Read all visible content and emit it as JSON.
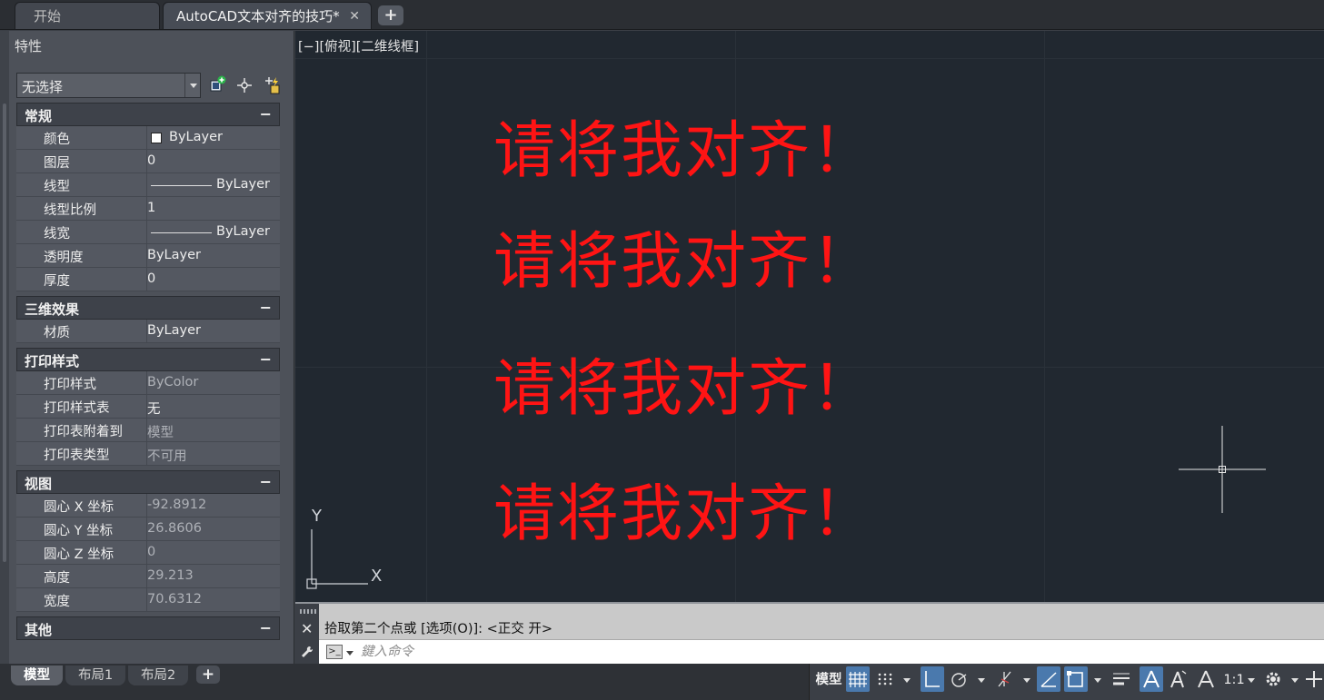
{
  "tabs": {
    "start": "开始",
    "active": "AutoCAD文本对齐的技巧*",
    "close_glyph": "✕",
    "add_glyph": "+"
  },
  "properties": {
    "title": "特性",
    "selection": "无选择",
    "sections": {
      "general": "常规",
      "three_d": "三维效果",
      "plot_style": "打印样式",
      "view": "视图",
      "misc": "其他"
    },
    "collapse_glyph": "−",
    "general": {
      "color": {
        "name": "颜色",
        "value": "ByLayer"
      },
      "layer": {
        "name": "图层",
        "value": "0"
      },
      "linetype": {
        "name": "线型",
        "value": "ByLayer"
      },
      "linetype_scale": {
        "name": "线型比例",
        "value": "1"
      },
      "lineweight": {
        "name": "线宽",
        "value": "ByLayer"
      },
      "transparency": {
        "name": "透明度",
        "value": "ByLayer"
      },
      "thickness": {
        "name": "厚度",
        "value": "0"
      }
    },
    "three_d": {
      "material": {
        "name": "材质",
        "value": "ByLayer"
      }
    },
    "plot_style": {
      "style": {
        "name": "打印样式",
        "value": "ByColor"
      },
      "table": {
        "name": "打印样式表",
        "value": "无"
      },
      "attached_to": {
        "name": "打印表附着到",
        "value": "模型"
      },
      "table_type": {
        "name": "打印表类型",
        "value": "不可用"
      }
    },
    "view": {
      "center_x": {
        "name": "圆心 X 坐标",
        "value": "-92.8912"
      },
      "center_y": {
        "name": "圆心 Y 坐标",
        "value": "26.8606"
      },
      "center_z": {
        "name": "圆心 Z 坐标",
        "value": "0"
      },
      "height": {
        "name": "高度",
        "value": "29.213"
      },
      "width": {
        "name": "宽度",
        "value": "70.6312"
      }
    }
  },
  "canvas": {
    "view_label": "[−][俯视][二维线框]",
    "text_lines": [
      "请将我对齐！",
      "请将我对齐！",
      "请将我对齐！",
      "请将我对齐！"
    ],
    "text_color": "#ff1414",
    "ucs_x": "X",
    "ucs_y": "Y"
  },
  "command": {
    "history": "拾取第二个点或 [选项(O)]:  <正交 开>",
    "placeholder": "鍵入命令",
    "close_glyph": "✕",
    "prompt_glyph": ">_"
  },
  "layout_tabs": [
    "模型",
    "布局1",
    "布局2"
  ],
  "layout_add": "+",
  "status": {
    "model": "模型",
    "scale": "1:1",
    "accent": "#4a79ad"
  }
}
